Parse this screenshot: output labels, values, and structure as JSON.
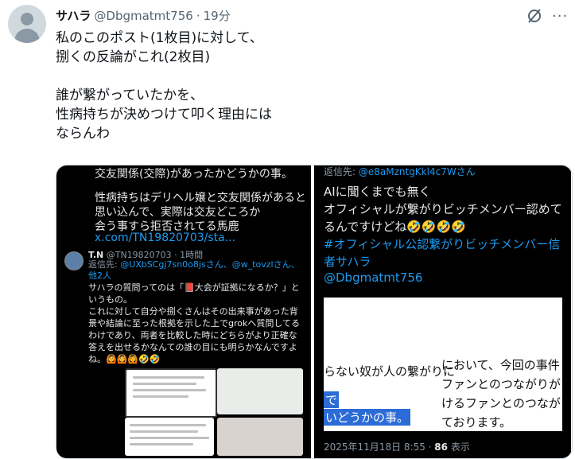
{
  "post": {
    "name": "サハラ",
    "handle": "@Dbgmatmt756",
    "separator": "·",
    "time": "19分",
    "text": "私のこのポスト(1枚目)に対して、\n捌くの反論がこれ(2枚目)\n\n誰が繋がっていたかを、\n性病持ちが決めつけて叩く理由には\nならんわ"
  },
  "image1": {
    "top_text": "交友関係(交際)があったかどうかの事。",
    "para": "性病持ちはデリヘル嬢と交友関係があると思い込んで、実際は交友どころか\n会う事すら拒否されてる馬鹿",
    "link": "x.com/TN19820703/sta...",
    "reply_name": "T.N",
    "reply_handle": "@TN19820703 · 1時間",
    "reply_to_label": "返信先: ",
    "reply_to": "@UXbSCgj7sn0o8jsさん、@w_tovzlさん、他2人",
    "reply_body": "サハラの質問ってのは「📕大会が証拠になるか？」というもの。\nこれに対して自分や捌くさんはその出来事があった背景や結論に至った根拠を示した上でgrokへ質問してるわけであり、両者を比較した時にどちらがより正確な答えを出せるかなんての誰の目にも明らかなんですよね。🙆🙆🙆🤣🤣"
  },
  "image2": {
    "reply_to_label": "返信先: ",
    "reply_to": "@e8aMzntgKkl4c7Wさん",
    "body": "AIに聞くまでも無く\nオフィシャルが繋がりビッチメンバー認めてるんですけどね🤣🤣🤣🤣",
    "hashtag": "#オフィシャル公認繋がりビッチメンバー信者サハラ",
    "mention": "@Dbgmatmt756",
    "doc_left_line": "らない奴が人の繋がりに",
    "doc_left_hl1": "で",
    "doc_left_hl2": "いどうかの事。",
    "doc_right_1": "において、今回の事件",
    "doc_right_2": "ファンとのつながりが",
    "doc_right_3": "けるファンとのつなが",
    "doc_right_4": "ております。",
    "date": "2025年11月18日 8:55",
    "dot": " · ",
    "views": "86",
    "views_label": " 表示"
  }
}
